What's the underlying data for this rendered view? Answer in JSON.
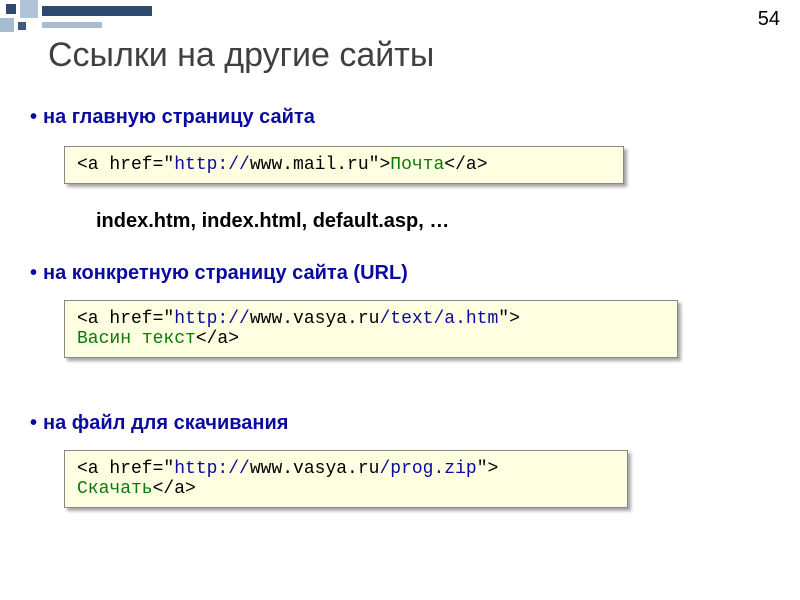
{
  "page_number": "54",
  "title": "Ссылки на другие сайты",
  "bullets": {
    "b1": "на главную страницу сайта",
    "b2": "на конкретную страницу сайта (URL)",
    "b3": "на файл для скачивания"
  },
  "note": "index.htm, index.html, default.asp, …",
  "code1": {
    "lt1": "<a href=\"",
    "proto": "http://",
    "url": "www.mail.ru",
    "gt1": "\">",
    "text": "Почта",
    "end": "</a>"
  },
  "code2": {
    "lt1": "<a href=\"",
    "proto": "http://",
    "host": "www.vasya.ru",
    "path": "/text/a.htm",
    "gt1": "\">",
    "text": "Васин текст",
    "end": "</a>"
  },
  "code3": {
    "lt1": "<a href=\"",
    "proto": "http://",
    "host": "www.vasya.ru",
    "path": "/prog.zip",
    "gt1": "\">",
    "text": "Скачать",
    "end": "</a>"
  }
}
